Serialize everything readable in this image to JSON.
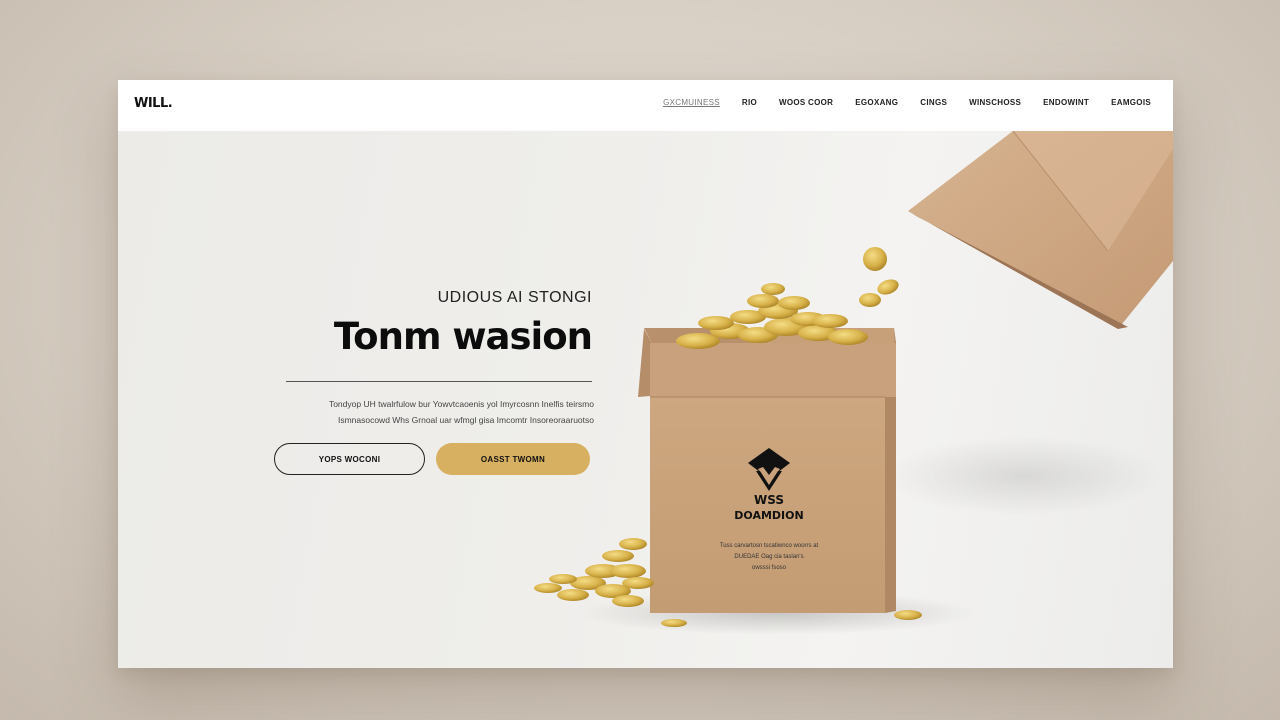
{
  "header": {
    "logo": "WILL.",
    "nav": [
      "GXCMUINESS",
      "RIO",
      "WOOS COOR",
      "EGOXANG",
      "CINGS",
      "WINSCHOSS",
      "ENDOWINT",
      "EAMGOIS"
    ]
  },
  "hero": {
    "eyebrow": "UDIOUS AI STONGI",
    "headline": "Tonm wasion",
    "body_line1": "Tondyop UH twalrfulow bur Yowvtcaoenis yol Imyrcosnn Inelfis teirsmo",
    "body_line2": "Ismnasocowd Whs Grnoal uar wfmgl gisa Imcomtr Insoreoraaruotso",
    "button_outline": "YOPS WOCONI",
    "button_gold": "OASST TWOMN"
  },
  "box": {
    "brand_line1": "WSS",
    "brand_line2": "DOAMDION",
    "small_line1": "Tuss carvartosn tscatiwnco woorrs at",
    "small_line2": "DUEDAE Oag cia taslan's",
    "small_line3": "owsssi fsoso"
  },
  "colors": {
    "accent_gold": "#d8b061",
    "cardboard": "#c9a27d",
    "coin": "#d8b24a",
    "text_dark": "#0c0c0c"
  }
}
